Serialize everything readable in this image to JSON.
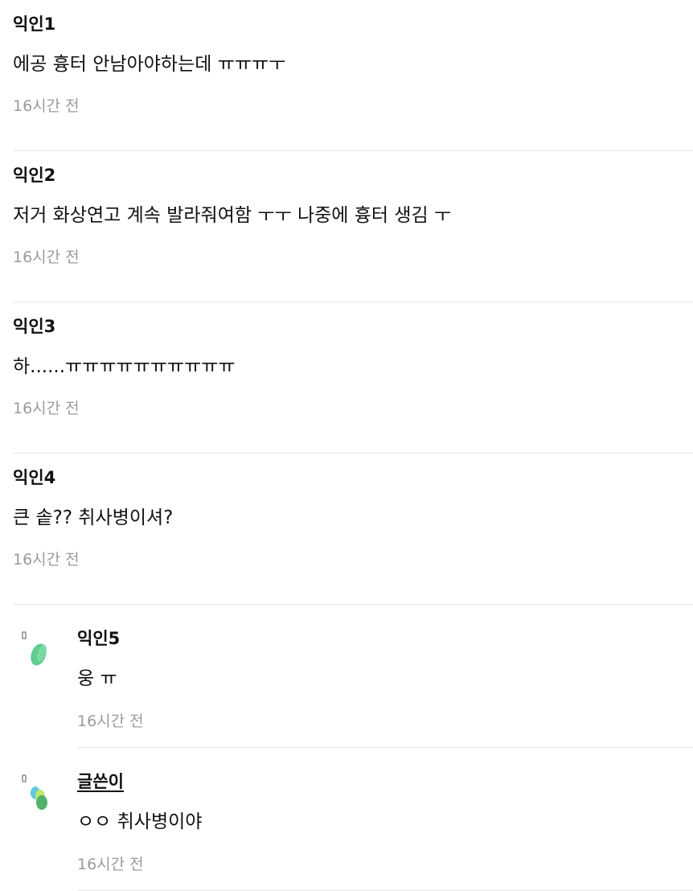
{
  "comments": [
    {
      "author": "익인1",
      "body": "에공 흉터 안남아야하는데 ㅠㅠㅠㅜ",
      "time": "16시간 전"
    },
    {
      "author": "익인2",
      "body": "저거 화상연고 계속 발라줘여함 ㅜㅜ 나중에 흉터 생김 ㅜ",
      "time": "16시간 전"
    },
    {
      "author": "익인3",
      "body": "하......ㅠㅠㅠㅠㅠㅠㅠㅠㅠㅠ",
      "time": "16시간 전"
    },
    {
      "author": "익인4",
      "body": "큰 솥?? 취사병이셔?",
      "time": "16시간 전"
    }
  ],
  "replies": [
    {
      "author": "익인5",
      "body": "웅 ㅠ",
      "time": "16시간 전",
      "icon": "reply-leaf-icon"
    },
    {
      "author": "글쓴이",
      "body": "ㅇㅇ 취사병이야",
      "time": "16시간 전",
      "icon": "reply-author-icon"
    }
  ],
  "colors": {
    "text": "#111111",
    "time": "#9b9b9b",
    "divider": "#e6e6e6",
    "leaf_green": "#56c98a",
    "author_cyan": "#62c9e0",
    "author_lime": "#c6e36a",
    "author_green": "#4fb36a"
  }
}
